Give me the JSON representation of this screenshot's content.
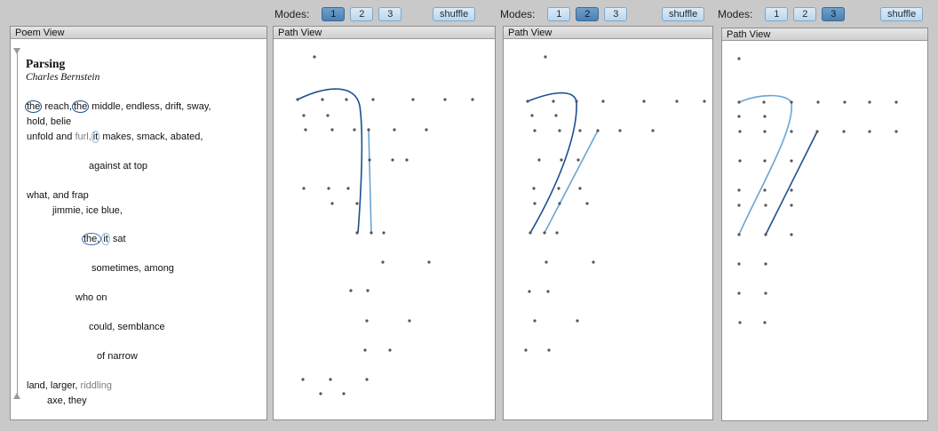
{
  "toolbars": [
    {
      "label": "Modes:",
      "buttons": [
        "1",
        "2",
        "3"
      ],
      "active": 0,
      "shuffle": "shuffle"
    },
    {
      "label": "Modes:",
      "buttons": [
        "1",
        "2",
        "3"
      ],
      "active": 1,
      "shuffle": "shuffle"
    },
    {
      "label": "Modes:",
      "buttons": [
        "1",
        "2",
        "3"
      ],
      "active": 2,
      "shuffle": "shuffle"
    }
  ],
  "poem_view": {
    "header": "Poem View",
    "title": "Parsing",
    "author": "Charles Bernstein",
    "lines": {
      "l1_the1": "the",
      "l1_reach": " reach,",
      "l1_the2": "the",
      "l1_rest": " middle, endless, drift, sway,",
      "l2": "hold, belie",
      "l3_a": "unfold and ",
      "l3_furl": "furl,",
      "l3_it": "it",
      "l3_rest": " makes, smack, abated,",
      "l4": "against at top",
      "l5": "what, and frap",
      "l6": "jimmie, ice blue,",
      "l7_the": "the,",
      "l7_it": "it",
      "l7_rest": " sat",
      "l8": "sometimes, among",
      "l9": "who on",
      "l10": "could, semblance",
      "l11": "of narrow",
      "l12_a": "land, larger, ",
      "l12_riddling": "riddling",
      "l13": "axe, they"
    }
  },
  "path_views": [
    {
      "header": "Path View"
    },
    {
      "header": "Path View"
    },
    {
      "header": "Path View"
    }
  ],
  "colors": {
    "dark_path": "#1a4f8f",
    "light_path": "#6aa5d2",
    "dot": "#555555"
  }
}
